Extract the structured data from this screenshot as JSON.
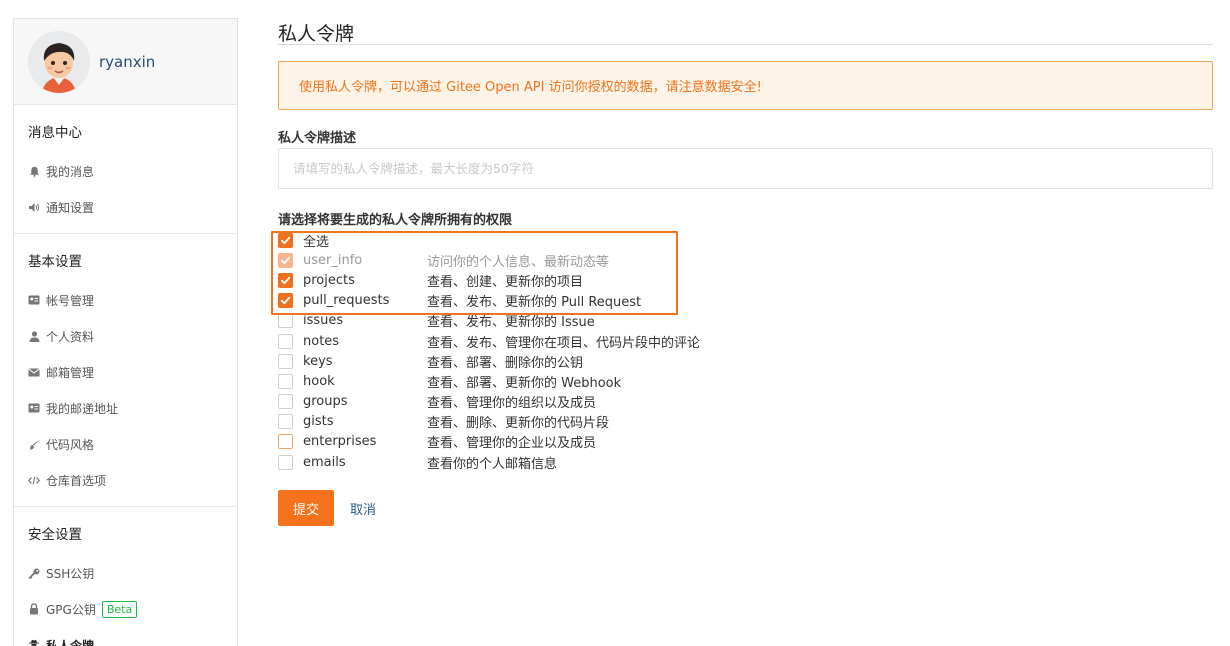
{
  "user": {
    "name": "ryanxin"
  },
  "sidebar": {
    "sections": [
      {
        "title": "消息中心",
        "items": [
          {
            "label": "我的消息",
            "icon": "bell-icon"
          },
          {
            "label": "通知设置",
            "icon": "volume-icon"
          }
        ]
      },
      {
        "title": "基本设置",
        "items": [
          {
            "label": "帐号管理",
            "icon": "id-card-icon"
          },
          {
            "label": "个人资料",
            "icon": "user-icon"
          },
          {
            "label": "邮箱管理",
            "icon": "envelope-icon"
          },
          {
            "label": "我的邮递地址",
            "icon": "address-card-icon"
          },
          {
            "label": "代码风格",
            "icon": "brush-icon"
          },
          {
            "label": "仓库首选项",
            "icon": "code-icon"
          }
        ]
      },
      {
        "title": "安全设置",
        "items": [
          {
            "label": "SSH公钥",
            "icon": "key-icon"
          },
          {
            "label": "GPG公钥",
            "icon": "lock-icon",
            "badge": "Beta"
          },
          {
            "label": "私人令牌",
            "icon": "user-secret-icon",
            "active": true
          }
        ]
      }
    ]
  },
  "main": {
    "title": "私人令牌",
    "notice": "使用私人令牌，可以通过 Gitee Open API 访问你授权的数据，请注意数据安全!",
    "desc_label": "私人令牌描述",
    "desc_placeholder": "请填写的私人令牌描述，最大长度为50字符",
    "desc_value": "",
    "perm_label": "请选择将要生成的私人令牌所拥有的权限",
    "permissions": [
      {
        "name": "全选",
        "desc": "",
        "checked": true
      },
      {
        "name": "user_info",
        "desc": "访问你的个人信息、最新动态等",
        "checked": true,
        "disabled": true
      },
      {
        "name": "projects",
        "desc": "查看、创建、更新你的项目",
        "checked": true
      },
      {
        "name": "pull_requests",
        "desc": "查看、发布、更新你的 Pull Request",
        "checked": true
      },
      {
        "name": "issues",
        "desc": "查看、发布、更新你的 Issue",
        "checked": false
      },
      {
        "name": "notes",
        "desc": "查看、发布、管理你在项目、代码片段中的评论",
        "checked": false
      },
      {
        "name": "keys",
        "desc": "查看、部署、删除你的公钥",
        "checked": false
      },
      {
        "name": "hook",
        "desc": "查看、部署、更新你的 Webhook",
        "checked": false
      },
      {
        "name": "groups",
        "desc": "查看、管理你的组织以及成员",
        "checked": false
      },
      {
        "name": "gists",
        "desc": "查看、删除、更新你的代码片段",
        "checked": false
      },
      {
        "name": "enterprises",
        "desc": "查看、管理你的企业以及成员",
        "checked": false,
        "focused": true
      },
      {
        "name": "emails",
        "desc": "查看你的个人邮箱信息",
        "checked": false
      }
    ],
    "submit_label": "提交",
    "cancel_label": "取消"
  },
  "colors": {
    "accent": "#f5711c",
    "notice_bg": "#fdf3e7",
    "notice_text": "#f0741c",
    "link": "#2b5c8c",
    "beta": "#21ba45"
  }
}
